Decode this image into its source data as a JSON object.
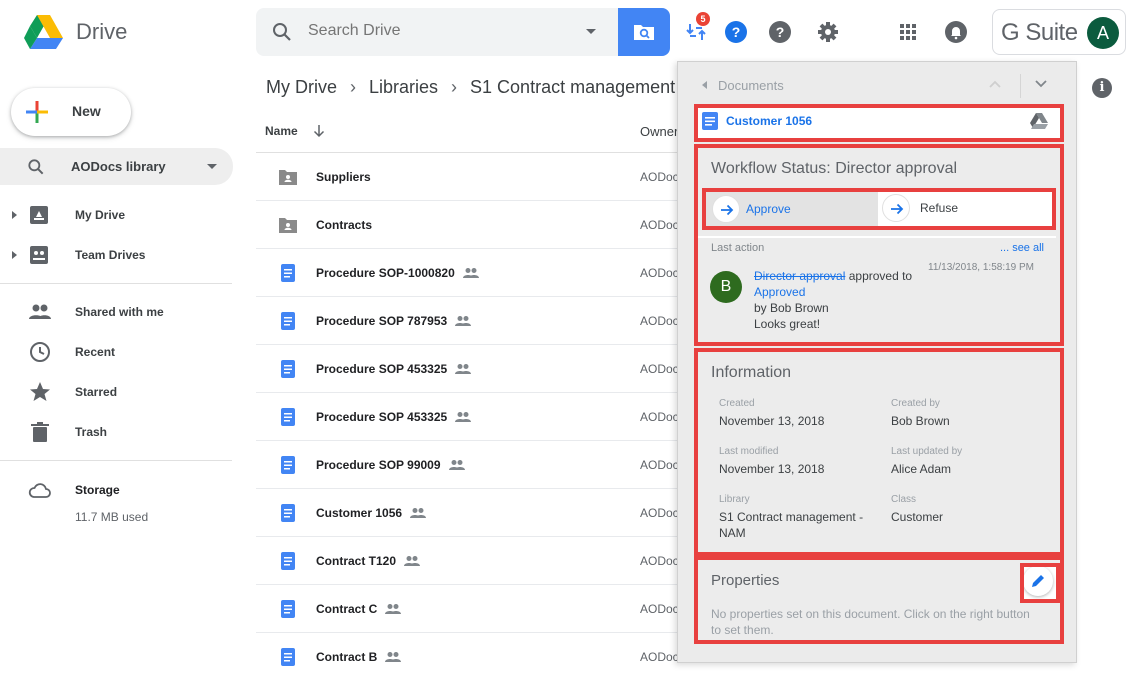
{
  "app": {
    "brand": "Drive"
  },
  "search": {
    "placeholder": "Search Drive"
  },
  "toolbar": {
    "notifications_badge": "5"
  },
  "account": {
    "suite": "G Suite",
    "avatar_initial": "A"
  },
  "sidebar": {
    "new_label": "New",
    "library_label": "AODocs library",
    "items": [
      {
        "label": "My Drive",
        "icon": "my-drive-icon"
      },
      {
        "label": "Team Drives",
        "icon": "team-drives-icon"
      },
      {
        "label": "Shared with me",
        "icon": "people-icon"
      },
      {
        "label": "Recent",
        "icon": "clock-icon"
      },
      {
        "label": "Starred",
        "icon": "star-icon"
      },
      {
        "label": "Trash",
        "icon": "trash-icon"
      }
    ],
    "storage_label": "Storage",
    "storage_used": "11.7 MB used"
  },
  "breadcrumb": [
    "My Drive",
    "Libraries",
    "S1 Contract management"
  ],
  "list": {
    "col_name": "Name",
    "col_owner": "Owner",
    "rows": [
      {
        "name": "Suppliers",
        "type": "folder",
        "shared": false,
        "owner": "AODocs"
      },
      {
        "name": "Contracts",
        "type": "folder",
        "shared": false,
        "owner": "AODocs"
      },
      {
        "name": "Procedure SOP-1000820",
        "type": "doc",
        "shared": true,
        "owner": "AODocs"
      },
      {
        "name": "Procedure SOP 787953",
        "type": "doc",
        "shared": true,
        "owner": "AODocs"
      },
      {
        "name": "Procedure SOP 453325",
        "type": "doc",
        "shared": true,
        "owner": "AODocs"
      },
      {
        "name": "Procedure SOP 453325",
        "type": "doc",
        "shared": true,
        "owner": "AODocs"
      },
      {
        "name": "Procedure SOP 99009",
        "type": "doc",
        "shared": true,
        "owner": "AODocs"
      },
      {
        "name": "Customer 1056",
        "type": "doc",
        "shared": true,
        "owner": "AODocs"
      },
      {
        "name": "Contract T120",
        "type": "doc",
        "shared": true,
        "owner": "AODocs"
      },
      {
        "name": "Contract C",
        "type": "doc",
        "shared": true,
        "owner": "AODocs"
      },
      {
        "name": "Contract B",
        "type": "doc",
        "shared": true,
        "owner": "AODocs"
      }
    ]
  },
  "panel": {
    "header": "Documents",
    "doc_name": "Customer 1056",
    "workflow_title": "Workflow Status: Director approval",
    "approve_label": "Approve",
    "refuse_label": "Refuse",
    "last_action_label": "Last action",
    "see_all": "... see all",
    "history": {
      "avatar_initial": "B",
      "from_state": "Director approval",
      "verb": "approved to",
      "to_state": "Approved",
      "by": "by Bob Brown",
      "comment": "Looks great!",
      "date": "11/13/2018, 1:58:19 PM"
    },
    "information_title": "Information",
    "fields": [
      {
        "label": "Created",
        "value": "November 13, 2018"
      },
      {
        "label": "Created by",
        "value": "Bob Brown"
      },
      {
        "label": "Last modified",
        "value": "November 13, 2018"
      },
      {
        "label": "Last updated by",
        "value": "Alice Adam"
      },
      {
        "label": "Library",
        "value": "S1 Contract management - NAM"
      },
      {
        "label": "Class",
        "value": "Customer"
      }
    ],
    "properties_title": "Properties",
    "properties_desc": "No properties set on this document. Click on the right button to set them."
  },
  "colors": {
    "accent": "#4285f4",
    "link": "#1a73e8",
    "highlight": "#e8403f",
    "badge": "#ea4335"
  }
}
